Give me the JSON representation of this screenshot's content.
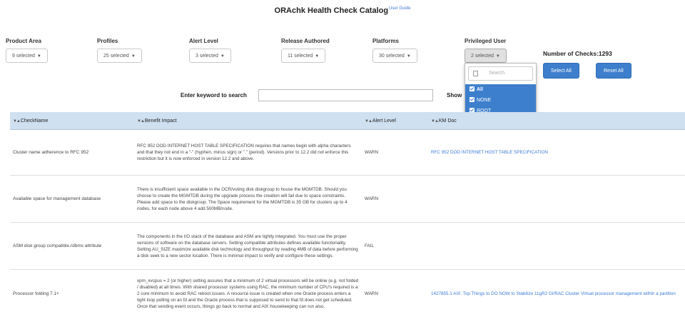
{
  "header": {
    "title": "ORAchk Health Check Catalog",
    "guide_link": "User Guide"
  },
  "filters": [
    {
      "label": "Product Area",
      "value": "9 selected"
    },
    {
      "label": "Profiles",
      "value": "25 selected"
    },
    {
      "label": "Alert Level",
      "value": "3 selected"
    },
    {
      "label": "Release Authored",
      "value": "11 selected"
    },
    {
      "label": "Platforms",
      "value": "30 selected"
    },
    {
      "label": "Privileged User",
      "value": "2 selected"
    }
  ],
  "number_of_checks": "Number of Checks:1293",
  "buttons": {
    "select_all": "Select All",
    "reset_all": "Reset All"
  },
  "privileged_dropdown": {
    "search_placeholder": "Search",
    "options": [
      {
        "label": "All",
        "checked": true
      },
      {
        "label": "NONE",
        "checked": true
      },
      {
        "label": "ROOT",
        "checked": true
      }
    ]
  },
  "keyword": {
    "label": "Enter keyword to search",
    "value": ""
  },
  "show_label": "Show",
  "table": {
    "columns": [
      "CheckName",
      "Benefit Impact",
      "Alert Level",
      "KM Doc"
    ],
    "rows": [
      {
        "check": "Cluster name adherence to RFC 952",
        "benefit": "RFC 952 DOD INTERNET HOST TABLE SPECIFICATION requires that names begin with alpha characters and that they not end in a \"-\" (hyphen, minus sign) or \".\" (period). Versions prior to 12.2 did not enforce this restriction but it is now enforced in version 12.2 and above.",
        "alert": "WARN",
        "km": "RFC 952 DOD INTERNET HOST TABLE SPECIFICATION"
      },
      {
        "check": "Available space for management database",
        "benefit": "There is insufficient space available in the OCR/voting disk diskgroup to house the MGMTDB. Should you choose to create the MGMTDB during the upgrade process the creation will fail due to space constraints. Please add space to the diskgroup. The Space requirement for the MGMTDB is 35 GB for clusters up to 4 nodes, for each node above 4 add 500MB/node.",
        "alert": "WARN",
        "km": ""
      },
      {
        "check": "ASM disk group compatible.rdbms attribute",
        "benefit": "The components in the I/O stack of the database and ASM are tightly integrated. You must use the proper versions of software on the database servers. Setting compatible attributes defines available functionality. Setting AU_SIZE maximize available disk technology and throughput by reading 4MB of data before performing a disk seek to a new sector location. There is minimal impact to verify and configure these settings.",
        "alert": "FAIL",
        "km": ""
      },
      {
        "check": "Processor folding 7.1+",
        "benefit": "vpm_xvcpus = 2 (or higher) setting assures that a minimum of 2 virtual processors will be online (e.g. not folded / disabled) at all times. With shared processor systems using RAC, the minimum number of CPU's required is a 2 core minimum to avoid RAC reboot issues. A resource issue is created when one Oracle process enters a tight loop polling on an fd and the Oracle process that is supposed to send to that fd does not get scheduled. Once that sending event occurs, things go back to normal and AIX housekeeping can run also.",
        "alert": "WARN",
        "km": "1427855.1 AIX: Top Things to DO NOW to Stabilize 11gR2 GI/RAC Cluster Virtual processor management within a partition"
      }
    ]
  }
}
